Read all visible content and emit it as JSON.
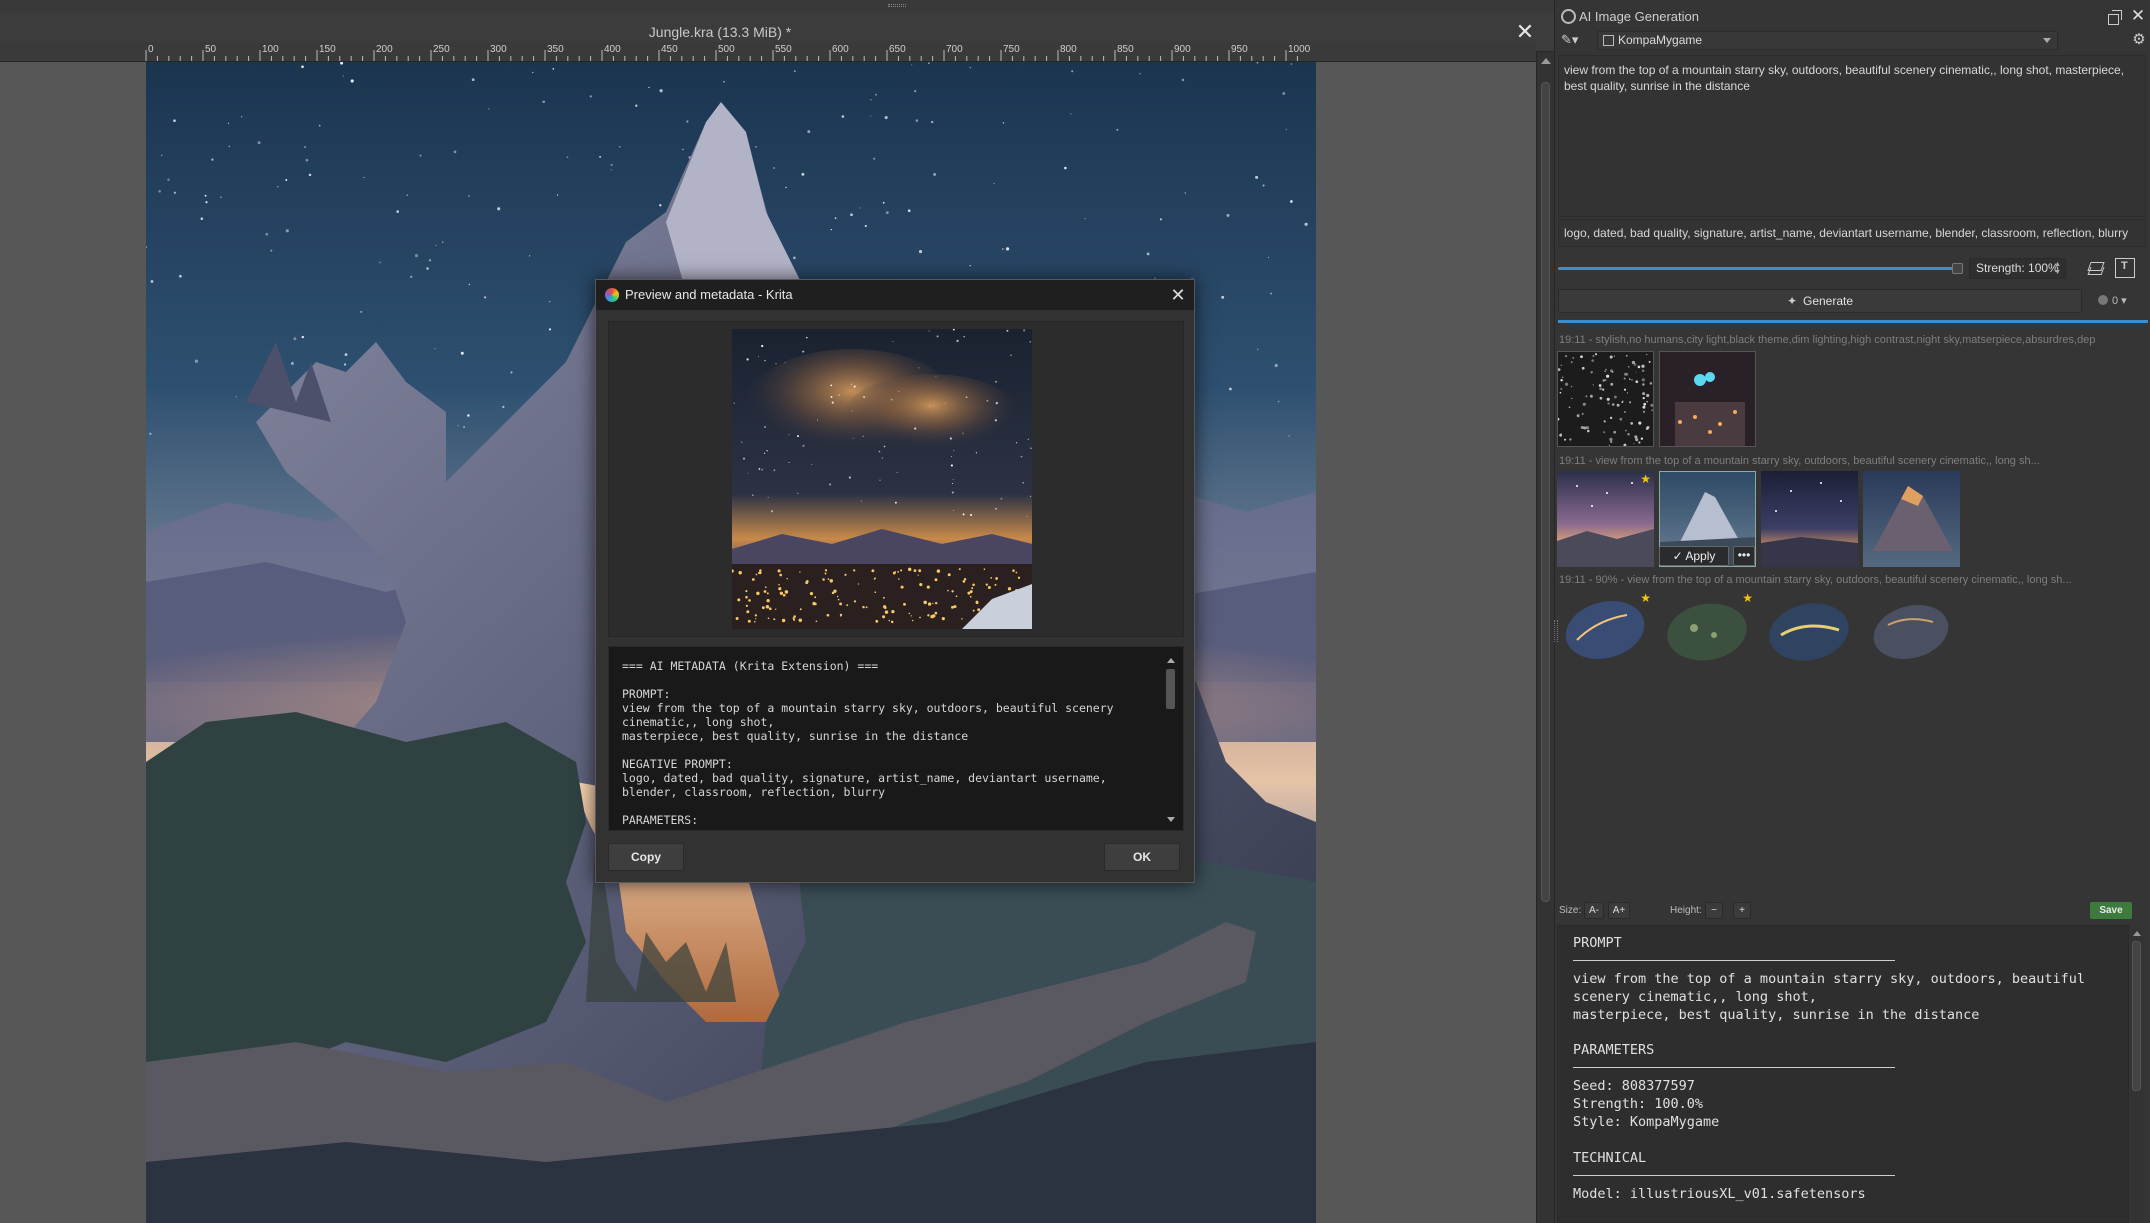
{
  "document": {
    "tab_title": "Jungle.kra (13.3 MiB) *",
    "ruler_ticks": [
      "0",
      "50",
      "100",
      "150",
      "200",
      "250",
      "300",
      "350",
      "400",
      "450",
      "500",
      "550",
      "600",
      "650",
      "700",
      "750",
      "800",
      "850",
      "900",
      "950",
      "1000"
    ]
  },
  "dialog": {
    "title": "Preview and metadata - Krita",
    "metadata_text": "=== AI METADATA (Krita Extension) ===\n\nPROMPT:\nview from the top of a mountain starry sky, outdoors, beautiful scenery\ncinematic,, long shot,\nmasterpiece, best quality, sunrise in the distance\n\nNEGATIVE PROMPT:\nlogo, dated, bad quality, signature, artist_name, deviantart username,\nblender, classroom, reflection, blurry\n\nPARAMETERS:",
    "copy_label": "Copy",
    "ok_label": "OK"
  },
  "docker": {
    "title": "AI Image Generation",
    "style": "KompaMygame",
    "prompt": "view from the top of a mountain starry sky, outdoors, beautiful scenery cinematic,, long shot, masterpiece, best quality, sunrise in the distance",
    "negative_prompt": "logo, dated, bad quality, signature, artist_name, deviantart username, blender, classroom, reflection, blurry",
    "strength_label": "Strength: 100%",
    "strength_value": 1.0,
    "generate_label": "Generate",
    "queue_count": "0",
    "history": [
      {
        "caption": "19:11 - stylish,no humans,city light,black theme,dim lighting,high contrast,night sky,matserpiece,absurdres,dep"
      },
      {
        "caption": "19:11 - view from the top of a mountain starry sky, outdoors, beautiful scenery cinematic,, long sh..."
      },
      {
        "caption": "19:11 - 90% - view from the top of a mountain starry sky, outdoors, beautiful scenery cinematic,, long sh..."
      }
    ],
    "apply_label": "Apply",
    "more_label": "•••"
  },
  "metadata_toolbar": {
    "size_label": "Size:",
    "size_down": "A-",
    "size_up": "A+",
    "height_label": "Height:",
    "height_down": "−",
    "height_up": "+",
    "save_label": "Save"
  },
  "metadata_panel": {
    "prompt_heading": "PROMPT",
    "prompt_text": "view from the top of a mountain starry sky, outdoors, beautiful\nscenery cinematic,, long shot,\nmasterpiece, best quality, sunrise in the distance",
    "params_heading": "PARAMETERS",
    "params_text": "Seed: 808377597\nStrength: 100.0%\nStyle: KompaMygame",
    "technical_heading": "TECHNICAL",
    "technical_text": "Model: illustriousXL_v01.safetensors"
  },
  "colors": {
    "accent": "#3d8ecf",
    "star": "#f1c40f",
    "save_green": "#3d7b3d"
  }
}
